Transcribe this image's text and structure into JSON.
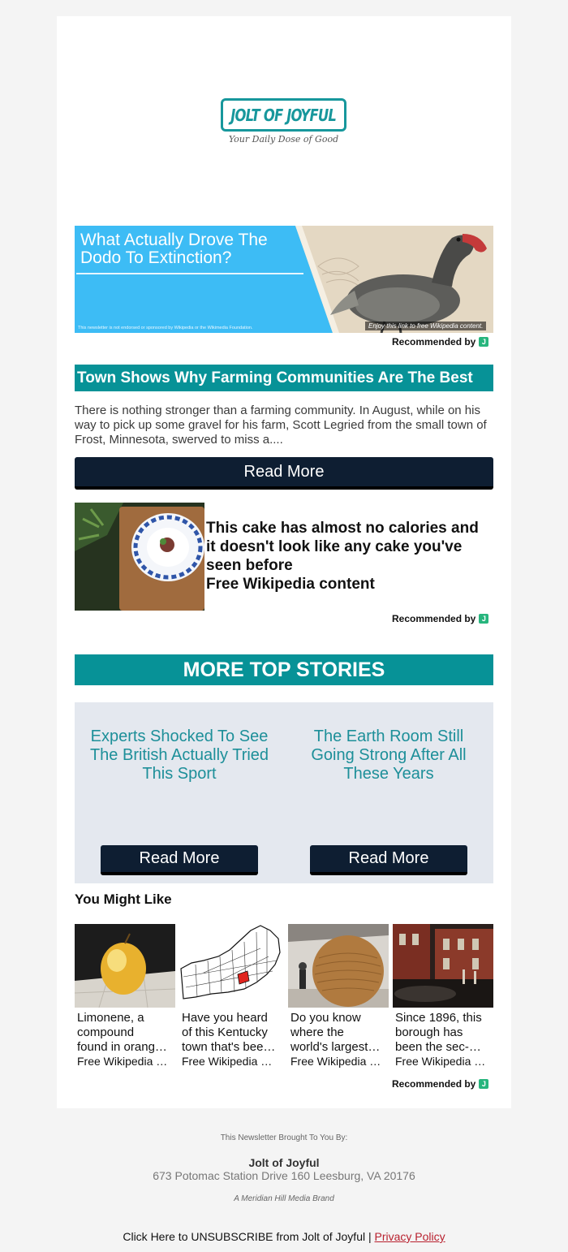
{
  "header": {
    "logo_text": "JOLT OF JOYFUL",
    "tagline": "Your Daily Dose of Good"
  },
  "hero_ad": {
    "title": "What Actually Drove The Dodo To Extinction?",
    "disclaimer": "This newsletter is not endorsed or sponsored by Wikipedia or the Wikimedia Foundation.",
    "overlay_note": "Enjoy this link to free Wikipedia content.",
    "image_icon": "dodo-bird-illustration",
    "bg_color": "#3dbcf5"
  },
  "recommended": {
    "label": "Recommended by",
    "badge": "J"
  },
  "article": {
    "title": "Town Shows Why Farming Communities Are The Best",
    "body": "There is nothing stronger than a farming community. In August, while on his way to pick up some gravel for his farm, Scott Legried from the small town of Frost, Minnesota, swerved to miss a....",
    "read_more": "Read More",
    "title_color": "#079297"
  },
  "cake_ad": {
    "title": "This cake has almost no calories and it doesn't look like any cake you've seen before",
    "source": "Free Wikipedia content",
    "image_icon": "plated-cake-photo"
  },
  "more_top_stories": {
    "heading": "MORE TOP STORIES",
    "items": [
      {
        "title": "Experts Shocked To See The British Actually Tried This Sport",
        "button": "Read More"
      },
      {
        "title": "The Earth Room Still Going Strong After All These Years",
        "button": "Read More"
      }
    ]
  },
  "you_might_like": {
    "heading": "You Might Like",
    "tiles": [
      {
        "line1": "Limonene, a",
        "line2": "compound",
        "line3": "found in orang…",
        "source": "Free Wikipedia …",
        "image_icon": "yellow-fruit-photo"
      },
      {
        "line1": "Have you heard",
        "line2": "of this Kentucky",
        "line3": "town that's bee…",
        "source": "Free Wikipedia …",
        "image_icon": "kentucky-county-map"
      },
      {
        "line1": "Do you know",
        "line2": "where the",
        "line3": "world's largest…",
        "source": "Free Wikipedia …",
        "image_icon": "twine-ball-photo"
      },
      {
        "line1": "Since 1896, this",
        "line2": "borough has",
        "line3": "been the sec-…",
        "source": "Free Wikipedia …",
        "image_icon": "borough-street-photo"
      }
    ]
  },
  "footer": {
    "brought_by": "This Newsletter Brought To You By:",
    "company": "Jolt of Joyful",
    "address": "673 Potomac Station Drive 160 Leesburg, VA 20176",
    "brand": "A Meridian Hill Media Brand",
    "unsubscribe": "Click Here to UNSUBSCRIBE from Jolt of Joyful | ",
    "privacy": "Privacy Policy",
    "privacy_color": "#b8202e"
  }
}
